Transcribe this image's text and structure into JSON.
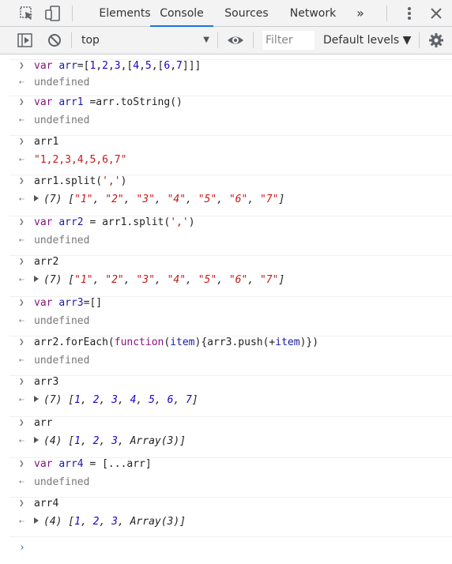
{
  "tabs": [
    {
      "label": "Elements"
    },
    {
      "label": "Console"
    },
    {
      "label": "Sources"
    },
    {
      "label": "Network"
    }
  ],
  "more_tabs": "»",
  "context": {
    "value": "top",
    "arrow": "▼"
  },
  "filter": {
    "placeholder": "Filter"
  },
  "levels": {
    "label": "Default levels ▼"
  },
  "icons": [
    "inspect-icon",
    "device-toolbar-icon",
    "more-menu-icon",
    "close-icon",
    "sidebar-toggle-icon",
    "clear-console-icon",
    "eye-icon",
    "settings-icon"
  ],
  "entries": [
    {
      "in": "var arr=[1,2,3,[4,5,[6,7]]]",
      "out": "undefined"
    },
    {
      "in": "var arr1 =arr.toString()",
      "out": "undefined"
    },
    {
      "in": "arr1",
      "out": "\"1,2,3,4,5,6,7\""
    },
    {
      "in": "arr1.split(',')",
      "out": "(7) [\"1\", \"2\", \"3\", \"4\", \"5\", \"6\", \"7\"]"
    },
    {
      "in": "var arr2 = arr1.split(',')",
      "out": "undefined"
    },
    {
      "in": "arr2",
      "out": "(7) [\"1\", \"2\", \"3\", \"4\", \"5\", \"6\", \"7\"]"
    },
    {
      "in": "var arr3=[]",
      "out": "undefined"
    },
    {
      "in": "arr2.forEach(function(item){arr3.push(+item)})",
      "out": "undefined"
    },
    {
      "in": "arr3",
      "out": "(7) [1, 2, 3, 4, 5, 6, 7]"
    },
    {
      "in": "arr",
      "out": "(4) [1, 2, 3, Array(3)]"
    },
    {
      "in": "var arr4 = [...arr]",
      "out": "undefined"
    },
    {
      "in": "arr4",
      "out": "(4) [1, 2, 3, Array(3)]"
    }
  ],
  "prompt": "›"
}
